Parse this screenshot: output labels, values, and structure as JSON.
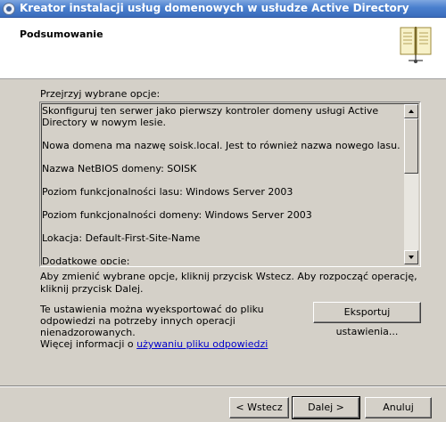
{
  "window": {
    "title": "Kreator instalacji usług domenowych w usłudze Active Directory",
    "icon": "ad-wizard-icon"
  },
  "header": {
    "title": "Podsumowanie",
    "icon": "book-icon"
  },
  "review": {
    "label": "Przejrzyj wybrane opcje:",
    "lines": [
      "Skonfiguruj ten serwer jako pierwszy kontroler domeny usługi Active Directory w nowym lesie.",
      "Nowa domena ma nazwę soisk.local. Jest to również nazwa nowego lasu.",
      "Nazwa NetBIOS domeny: SOISK",
      "Poziom funkcjonalności lasu: Windows Server 2003",
      "Poziom funkcjonalności domeny: Windows Server 2003",
      "Lokacja: Default-First-Site-Name",
      "Dodatkowe opcje:"
    ]
  },
  "info": {
    "text": "Aby zmienić wybrane opcje, kliknij przycisk Wstecz. Aby rozpocząć operację, kliknij przycisk Dalej."
  },
  "export": {
    "text": "Te ustawienia można wyeksportować do pliku odpowiedzi na potrzeby innych operacji nienadzorowanych.",
    "more_prefix": "Więcej informacji o ",
    "link": "używaniu pliku odpowiedzi",
    "button": "Eksportuj ustawienia..."
  },
  "buttons": {
    "back": "< Wstecz",
    "next": "Dalej >",
    "cancel": "Anuluj"
  },
  "colors": {
    "title_bar": "#4a7fce",
    "dialog_bg": "#d4d0c8",
    "link": "#0000cc"
  }
}
